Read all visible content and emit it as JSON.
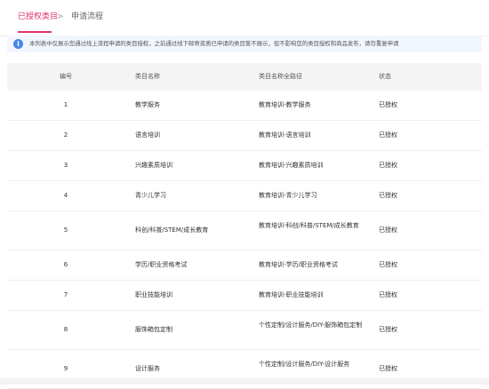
{
  "tabs": {
    "active": "已授权类目",
    "separator": ">",
    "second": "申请流程"
  },
  "notice": {
    "icon": "info-icon",
    "text": "本列表中仅展示您通过线上流程申请的类目授权，之前通过线下邮寄资质已申请的类目暂不展示，但不影响您的类目授权和商品发布，请勿重复申请"
  },
  "table": {
    "headers": [
      "编号",
      "类目名称",
      "类目名称全路径",
      "状态"
    ],
    "rows": [
      {
        "idx": "1",
        "name": "教学服务",
        "path": "教育培训-教学服务",
        "status": "已授权"
      },
      {
        "idx": "2",
        "name": "语言培训",
        "path": "教育培训-语言培训",
        "status": "已授权"
      },
      {
        "idx": "3",
        "name": "兴趣素质培训",
        "path": "教育培训-兴趣素质培训",
        "status": "已授权"
      },
      {
        "idx": "4",
        "name": "青少儿学习",
        "path": "教育培训-青少儿学习",
        "status": "已授权"
      },
      {
        "idx": "5",
        "name": "科创/科普/STEM/成长教育",
        "path": "教育培训-科创/科普/STEM/成长教育",
        "status": "已授权"
      },
      {
        "idx": "6",
        "name": "学历/职业资格考试",
        "path": "教育培训-学历/职业资格考试",
        "status": "已授权"
      },
      {
        "idx": "7",
        "name": "职业技能培训",
        "path": "教育培训-职业技能培训",
        "status": "已授权"
      },
      {
        "idx": "8",
        "name": "服饰箱包定制",
        "path": "个性定制/设计服务/DIY-服饰箱包定制",
        "status": "已授权"
      },
      {
        "idx": "9",
        "name": "设计服务",
        "path": "个性定制/设计服务/DIY-设计服务",
        "status": "已授权"
      }
    ]
  },
  "colors": {
    "accent": "#e0336a",
    "info": "#4a86e8",
    "header_bg": "#f5f5f5",
    "notice_bg": "#f2f6ff"
  }
}
